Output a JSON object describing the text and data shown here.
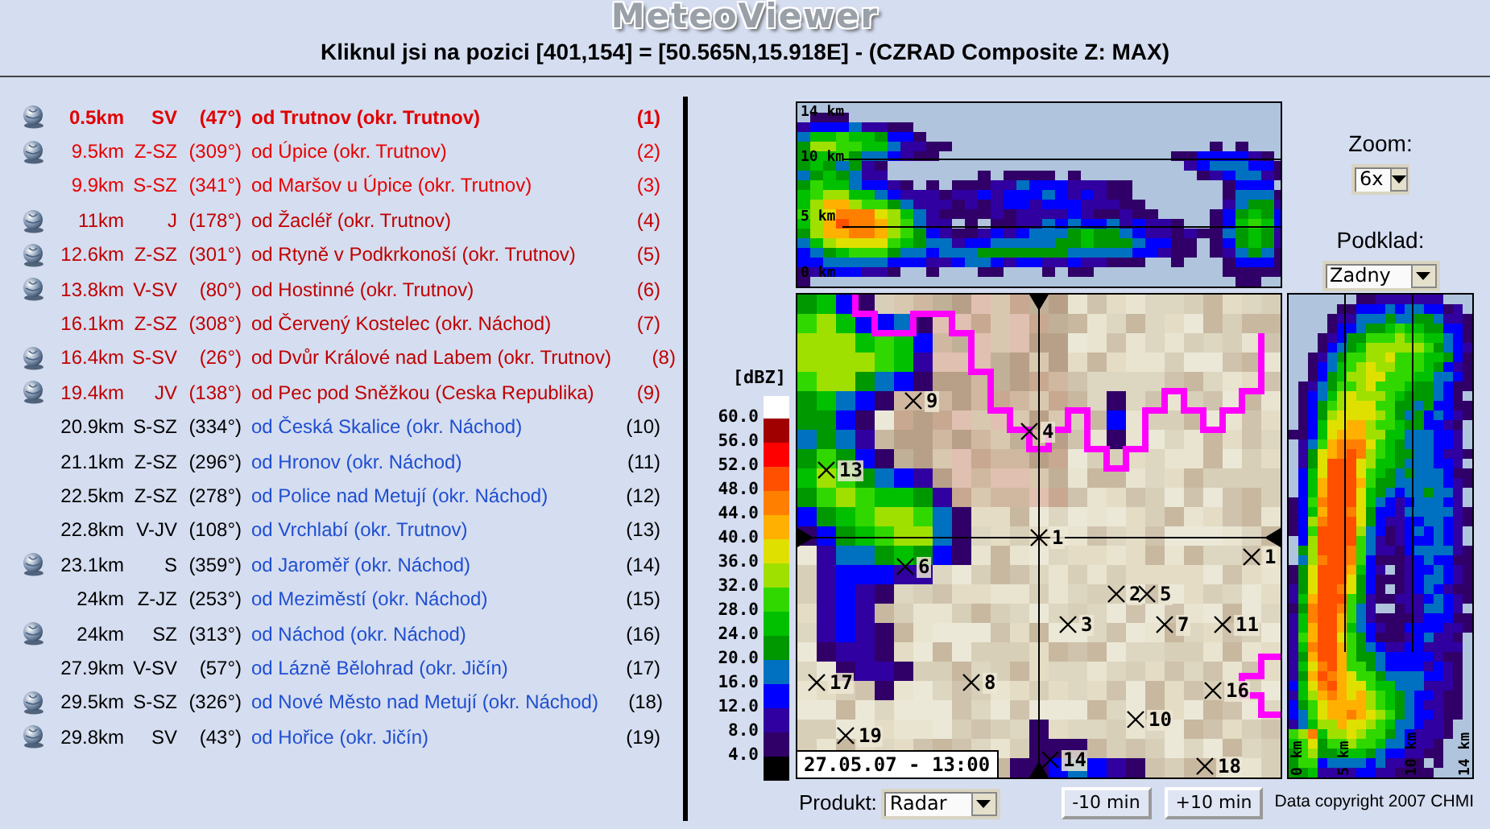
{
  "app": {
    "logo": "MeteoViewer",
    "subtitle": "Kliknul jsi na pozici [401,154] = [50.565N,15.918E] - (CZRAD Composite Z: MAX)"
  },
  "places": [
    {
      "globe": true,
      "kind": "nearest",
      "selected": true,
      "distance": "0.5km",
      "direction": "SV",
      "angle": "(47°)",
      "name": "od Trutnov (okr. Trutnov)",
      "index": "(1)"
    },
    {
      "globe": true,
      "kind": "close",
      "selected": false,
      "distance": "9.5km",
      "direction": "Z-SZ",
      "angle": "(309°)",
      "name": "od Úpice (okr. Trutnov)",
      "index": "(2)"
    },
    {
      "globe": false,
      "kind": "close",
      "selected": false,
      "distance": "9.9km",
      "direction": "S-SZ",
      "angle": "(341°)",
      "name": "od Maršov u Úpice (okr. Trutnov)",
      "index": "(3)"
    },
    {
      "globe": true,
      "kind": "medium",
      "selected": false,
      "distance": "11km",
      "direction": "J",
      "angle": "(178°)",
      "name": "od Žacléř (okr. Trutnov)",
      "index": "(4)"
    },
    {
      "globe": true,
      "kind": "medium",
      "selected": false,
      "distance": "12.6km",
      "direction": "Z-SZ",
      "angle": "(301°)",
      "name": "od Rtyně v Podkrkonoší (okr. Trutnov)",
      "index": "(5)"
    },
    {
      "globe": true,
      "kind": "medium",
      "selected": false,
      "distance": "13.8km",
      "direction": "V-SV",
      "angle": "(80°)",
      "name": "od Hostinné (okr. Trutnov)",
      "index": "(6)"
    },
    {
      "globe": false,
      "kind": "medium",
      "selected": false,
      "distance": "16.1km",
      "direction": "Z-SZ",
      "angle": "(308°)",
      "name": "od Červený Kostelec (okr. Náchod)",
      "index": "(7)"
    },
    {
      "globe": true,
      "kind": "medium",
      "selected": false,
      "distance": "16.4km",
      "direction": "S-SV",
      "angle": "(26°)",
      "name": "od Dvůr Králové nad Labem (okr. Trutnov)",
      "index": "(8)"
    },
    {
      "globe": true,
      "kind": "medium",
      "selected": false,
      "distance": "19.4km",
      "direction": "JV",
      "angle": "(138°)",
      "name": "od Pec pod Sněžkou (Ceska Republika)",
      "index": "(9)"
    },
    {
      "globe": false,
      "kind": "far",
      "selected": false,
      "distance": "20.9km",
      "direction": "S-SZ",
      "angle": "(334°)",
      "name": "od Česká Skalice (okr. Náchod)",
      "index": "(10)"
    },
    {
      "globe": false,
      "kind": "far",
      "selected": false,
      "distance": "21.1km",
      "direction": "Z-SZ",
      "angle": "(296°)",
      "name": "od Hronov (okr. Náchod)",
      "index": "(11)"
    },
    {
      "globe": false,
      "kind": "far",
      "selected": false,
      "distance": "22.5km",
      "direction": "Z-SZ",
      "angle": "(278°)",
      "name": "od Police nad Metují (okr. Náchod)",
      "index": "(12)"
    },
    {
      "globe": false,
      "kind": "far",
      "selected": false,
      "distance": "22.8km",
      "direction": "V-JV",
      "angle": "(108°)",
      "name": "od Vrchlabí (okr. Trutnov)",
      "index": "(13)"
    },
    {
      "globe": true,
      "kind": "far",
      "selected": false,
      "distance": "23.1km",
      "direction": "S",
      "angle": "(359°)",
      "name": "od Jaroměř (okr. Náchod)",
      "index": "(14)"
    },
    {
      "globe": false,
      "kind": "far",
      "selected": false,
      "distance": "24km",
      "direction": "Z-JZ",
      "angle": "(253°)",
      "name": "od Meziměstí (okr. Náchod)",
      "index": "(15)"
    },
    {
      "globe": true,
      "kind": "far",
      "selected": false,
      "distance": "24km",
      "direction": "SZ",
      "angle": "(313°)",
      "name": "od Náchod (okr. Náchod)",
      "index": "(16)"
    },
    {
      "globe": false,
      "kind": "far",
      "selected": false,
      "distance": "27.9km",
      "direction": "V-SV",
      "angle": "(57°)",
      "name": "od Lázně Bělohrad (okr. Jičín)",
      "index": "(17)"
    },
    {
      "globe": true,
      "kind": "far",
      "selected": false,
      "distance": "29.5km",
      "direction": "S-SZ",
      "angle": "(326°)",
      "name": "od Nové Město nad Metují (okr. Náchod)",
      "index": "(18)"
    },
    {
      "globe": true,
      "kind": "far",
      "selected": false,
      "distance": "29.8km",
      "direction": "SV",
      "angle": "(43°)",
      "name": "od Hořice (okr. Jičín)",
      "index": "(19)"
    }
  ],
  "section": {
    "altitude_labels": [
      "14 km",
      "10 km",
      "5 km",
      "0 km"
    ]
  },
  "zoom": {
    "label": "Zoom:",
    "value": "6x"
  },
  "background": {
    "label": "Podklad:",
    "value": "Zadny"
  },
  "legend": {
    "unit": "[dBZ]",
    "items": [
      {
        "label": "60.0",
        "color": "#a00000"
      },
      {
        "label": "56.0",
        "color": "#ff0000"
      },
      {
        "label": "52.0",
        "color": "#ff5000"
      },
      {
        "label": "48.0",
        "color": "#ff8000"
      },
      {
        "label": "44.0",
        "color": "#ffb000"
      },
      {
        "label": "40.0",
        "color": "#e0e000"
      },
      {
        "label": "36.0",
        "color": "#a0e000"
      },
      {
        "label": "32.0",
        "color": "#30d800"
      },
      {
        "label": "28.0",
        "color": "#00c000"
      },
      {
        "label": "24.0",
        "color": "#009800"
      },
      {
        "label": "20.0",
        "color": "#0070c0"
      },
      {
        "label": "16.0",
        "color": "#0000ff"
      },
      {
        "label": "12.0",
        "color": "#3000a0"
      },
      {
        "label": "8.0",
        "color": "#300068"
      },
      {
        "label": "4.0",
        "color": "#000000"
      }
    ]
  },
  "map": {
    "markers": [
      {
        "label": "9"
      },
      {
        "label": "4"
      },
      {
        "label": "13"
      },
      {
        "label": "1"
      },
      {
        "label": "1"
      },
      {
        "label": "6"
      },
      {
        "label": "2"
      },
      {
        "label": "5"
      },
      {
        "label": "3"
      },
      {
        "label": "7"
      },
      {
        "label": "11"
      },
      {
        "label": "17"
      },
      {
        "label": "8"
      },
      {
        "label": "16"
      },
      {
        "label": "10"
      },
      {
        "label": "19"
      },
      {
        "label": "14"
      },
      {
        "label": "18"
      }
    ],
    "timestamp": "27.05.07 - 13:00"
  },
  "side_section": {
    "altitude_labels": [
      "0 km",
      "5 km",
      "10 km",
      "14 km"
    ]
  },
  "product": {
    "label": "Produkt:",
    "value": "Radar"
  },
  "buttons": [
    "-10 min",
    "+10 min"
  ],
  "copyright": "Data copyright 2007 CHMI"
}
